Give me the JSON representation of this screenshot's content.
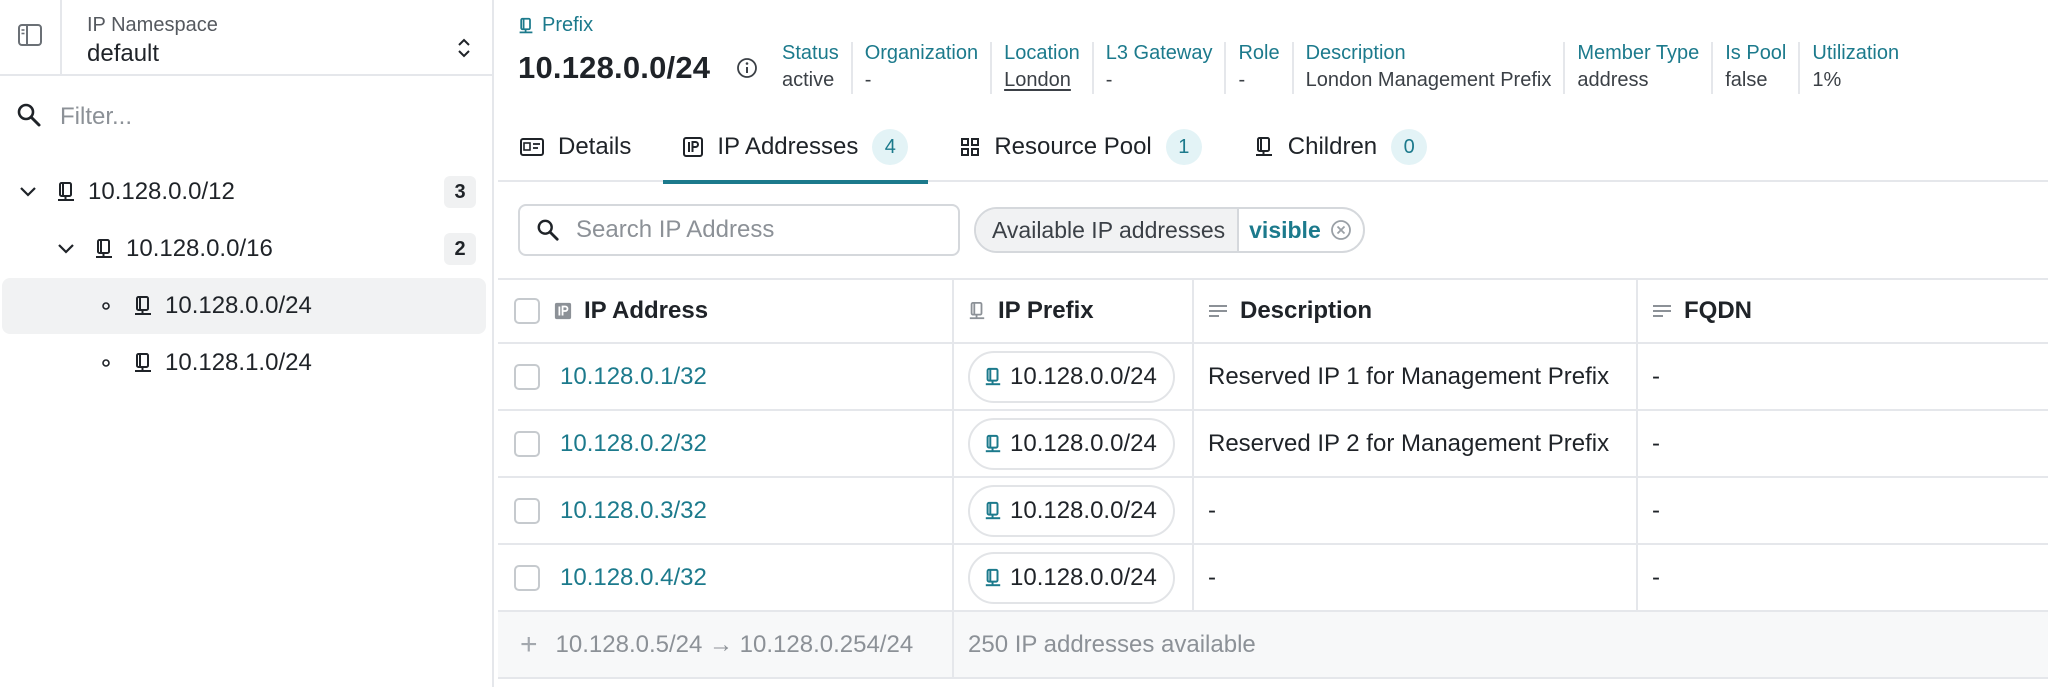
{
  "sidebar": {
    "namespace_label": "IP Namespace",
    "namespace_value": "default",
    "filter_placeholder": "Filter...",
    "tree": [
      {
        "label": "10.128.0.0/12",
        "count": "3",
        "level": 0,
        "expanded": true,
        "selected": false
      },
      {
        "label": "10.128.0.0/16",
        "count": "2",
        "level": 1,
        "expanded": true,
        "selected": false
      },
      {
        "label": "10.128.0.0/24",
        "count": "",
        "level": 2,
        "expanded": false,
        "selected": true
      },
      {
        "label": "10.128.1.0/24",
        "count": "",
        "level": 2,
        "expanded": false,
        "selected": false
      }
    ]
  },
  "header": {
    "object_type": "Prefix",
    "title": "10.128.0.0/24",
    "properties": [
      {
        "key": "Status",
        "value": "active"
      },
      {
        "key": "Organization",
        "value": "-"
      },
      {
        "key": "Location",
        "value": "London"
      },
      {
        "key": "L3 Gateway",
        "value": "-"
      },
      {
        "key": "Role",
        "value": "-"
      },
      {
        "key": "Description",
        "value": "London Management Prefix"
      },
      {
        "key": "Member Type",
        "value": "address"
      },
      {
        "key": "Is Pool",
        "value": "false"
      },
      {
        "key": "Utilization",
        "value": "1%"
      }
    ]
  },
  "tabs": [
    {
      "label": "Details",
      "badge": ""
    },
    {
      "label": "IP Addresses",
      "badge": "4",
      "active": true
    },
    {
      "label": "Resource Pool",
      "badge": "1"
    },
    {
      "label": "Children",
      "badge": "0"
    }
  ],
  "toolbar": {
    "search_placeholder": "Search IP Address",
    "filter_key": "Available IP addresses",
    "filter_value": "visible"
  },
  "table": {
    "columns": [
      "IP Address",
      "IP Prefix",
      "Description",
      "FQDN"
    ],
    "rows": [
      {
        "ip": "10.128.0.1/32",
        "prefix": "10.128.0.0/24",
        "description": "Reserved IP 1 for Management Prefix",
        "fqdn": "-"
      },
      {
        "ip": "10.128.0.2/32",
        "prefix": "10.128.0.0/24",
        "description": "Reserved IP 2 for Management Prefix",
        "fqdn": "-"
      },
      {
        "ip": "10.128.0.3/32",
        "prefix": "10.128.0.0/24",
        "description": "-",
        "fqdn": "-"
      },
      {
        "ip": "10.128.0.4/32",
        "prefix": "10.128.0.0/24",
        "description": "-",
        "fqdn": "-"
      }
    ],
    "available_range": "10.128.0.5/24 → 10.128.0.254/24",
    "available_text": "250 IP addresses available"
  },
  "colors": {
    "accent": "#1c7a8c",
    "badge_bg": "#e3f3f6",
    "selected_bg": "#f1f2f3"
  },
  "icons": {
    "sidebar_toggle": "sidebar-toggle-icon",
    "namespace_selector": "chevron-up-down-icon",
    "filter": "search-icon",
    "tree_expand": "chevron-down-icon",
    "tree_leaf": "bullet-icon",
    "prefix": "prefix-icon",
    "info": "info-icon",
    "details_tab": "id-card-icon",
    "ip_addresses_tab": "ip-icon",
    "resource_pool_tab": "grid-icon",
    "children_tab": "prefix-icon",
    "remove_filter": "close-circle-icon",
    "text_column": "text-lines-icon",
    "add": "plus-icon"
  }
}
